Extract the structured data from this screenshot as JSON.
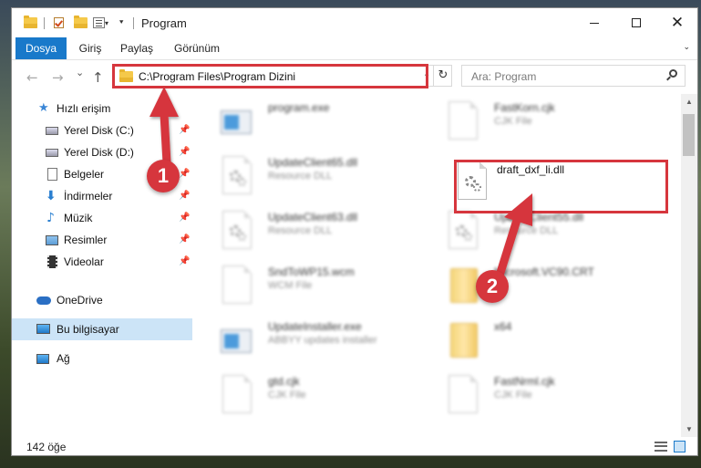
{
  "window": {
    "title": "Program",
    "controls": {
      "minimize": "",
      "maximize": "",
      "close": "✕"
    }
  },
  "ribbon": {
    "tabs": [
      "Dosya",
      "Giriş",
      "Paylaş",
      "Görünüm"
    ]
  },
  "nav": {
    "back": "←",
    "forward": "→",
    "recent": "⌄",
    "up": "↑",
    "address": "C:\\Program Files\\Program Dizini",
    "address_dropdown": "⌄",
    "refresh": "↻",
    "search_placeholder": "Ara: Program"
  },
  "sidebar": {
    "items": [
      {
        "label": "Hızlı erişim",
        "icon": "star-icon",
        "pinned": false
      },
      {
        "label": "Yerel Disk (C:)",
        "icon": "drive-icon",
        "pinned": true
      },
      {
        "label": "Yerel Disk (D:)",
        "icon": "drive-icon",
        "pinned": true
      },
      {
        "label": "Belgeler",
        "icon": "document-icon",
        "pinned": true
      },
      {
        "label": "İndirmeler",
        "icon": "download-icon",
        "pinned": true
      },
      {
        "label": "Müzik",
        "icon": "music-icon",
        "pinned": true
      },
      {
        "label": "Resimler",
        "icon": "pictures-icon",
        "pinned": true
      },
      {
        "label": "Videolar",
        "icon": "videos-icon",
        "pinned": true
      },
      {
        "label": "OneDrive",
        "icon": "cloud-icon",
        "pinned": false
      },
      {
        "label": "Bu bilgisayar",
        "icon": "computer-icon",
        "pinned": false,
        "selected": true
      },
      {
        "label": "Ağ",
        "icon": "network-icon",
        "pinned": false
      }
    ],
    "pin_glyph": "📌"
  },
  "files": {
    "left": [
      {
        "name": "program.exe",
        "type": "",
        "icon": "exe-icon"
      },
      {
        "name": "UpdateClient65.dll",
        "type": "Resource DLL",
        "icon": "dll-icon"
      },
      {
        "name": "UpdateClient63.dll",
        "type": "Resource DLL",
        "icon": "dll-icon"
      },
      {
        "name": "SndToWP15.wcm",
        "type": "WCM File",
        "icon": "file-icon"
      },
      {
        "name": "UpdateInstaller.exe",
        "type": "ABBYY updates installer",
        "icon": "installer-icon"
      },
      {
        "name": "gtd.cjk",
        "type": "CJK File",
        "icon": "file-icon"
      }
    ],
    "right": [
      {
        "name": "FastKorn.cjk",
        "type": "CJK File",
        "icon": "file-icon"
      },
      {
        "name": "draft_dxf_li.dll",
        "type": "",
        "icon": "dll-icon"
      },
      {
        "name": "UpdateClient55.dll",
        "type": "Resource DLL",
        "icon": "dll-icon"
      },
      {
        "name": "Microsoft.VC90.CRT",
        "type": "",
        "icon": "folder-icon"
      },
      {
        "name": "x64",
        "type": "",
        "icon": "folder-icon"
      },
      {
        "name": "FastNrml.cjk",
        "type": "CJK File",
        "icon": "file-icon"
      }
    ]
  },
  "annotations": {
    "badge1": "1",
    "badge2": "2",
    "color": "#d6363d"
  },
  "status": {
    "item_count": "142 öğe"
  },
  "colors": {
    "accent": "#1979ca",
    "selection": "#cce4f7",
    "highlight": "#d6363d"
  }
}
